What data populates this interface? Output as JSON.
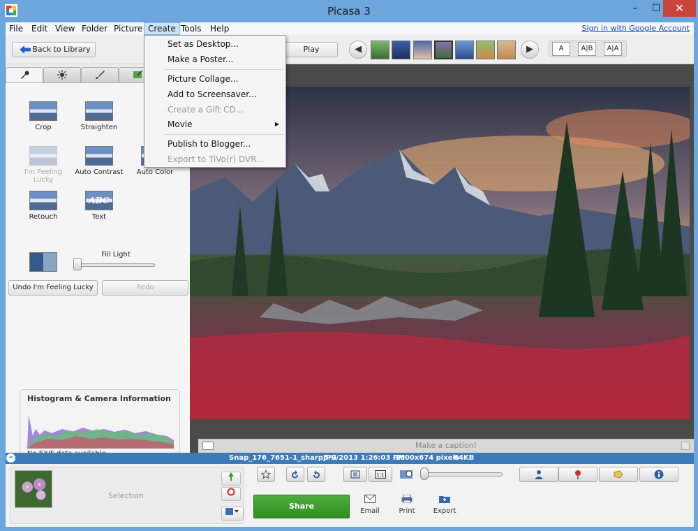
{
  "window": {
    "title": "Picasa 3",
    "minimize": "–",
    "maximize": "☐",
    "close": "✕"
  },
  "menubar": {
    "items": [
      "File",
      "Edit",
      "View",
      "Folder",
      "Picture",
      "Create",
      "Tools",
      "Help"
    ],
    "signin": "Sign in with Google Account"
  },
  "toolbar": {
    "back_label": "Back to Library",
    "play_label": "Play",
    "prev": "◀",
    "next": "▶",
    "caption_modes": [
      "A",
      "A|B",
      "A|A"
    ]
  },
  "create_menu": {
    "items": [
      {
        "label": "Set as Desktop...",
        "disabled": false
      },
      {
        "label": "Make a Poster...",
        "disabled": false
      },
      {
        "label": "Picture Collage...",
        "disabled": false
      },
      {
        "label": "Add to Screensaver...",
        "disabled": false
      },
      {
        "label": "Create a Gift CD...",
        "disabled": true
      },
      {
        "label": "Movie",
        "disabled": false,
        "submenu": true
      },
      {
        "label": "Publish to Blogger...",
        "disabled": false
      },
      {
        "label": "Export to TiVo(r) DVR...",
        "disabled": true
      }
    ]
  },
  "edit_panel": {
    "tabs": [
      "wrench-icon",
      "sun-icon",
      "brush-icon",
      "brush-green-icon"
    ],
    "tools": [
      {
        "label": "Crop",
        "disabled": false
      },
      {
        "label": "Straighten",
        "disabled": false
      },
      {
        "label": "I'm Feeling Lucky",
        "disabled": true
      },
      {
        "label": "Auto Contrast",
        "disabled": false
      },
      {
        "label": "Auto Color",
        "disabled": false
      },
      {
        "label": "Retouch",
        "disabled": false
      },
      {
        "label": "Text",
        "disabled": false
      }
    ],
    "text_tool_glyph": "ABC",
    "fill_light_label": "Fill Light",
    "fill_light_value": 0,
    "undo_label": "Undo I'm Feeling Lucky",
    "redo_label": "Redo",
    "histogram_title": "Histogram & Camera Information",
    "exif_note": "No EXIF data available."
  },
  "viewer": {
    "caption_placeholder": "Make a caption!"
  },
  "statusbar": {
    "collapse": "«",
    "filename": "Snap_176_7651-1_sharpJPG",
    "datetime": "5/9/2013 1:26:03 PM",
    "dimensions": "1000x674 pixels",
    "size": "64KB"
  },
  "tray": {
    "selection_label": "Selection",
    "share_label": "Share",
    "email_label": "Email",
    "print_label": "Print",
    "export_label": "Export"
  },
  "colors": {
    "accent": "#3d7ab8",
    "title_bar": "#6ca6dd",
    "share_green": "#3b9d2c",
    "close_red": "#c9443a"
  }
}
